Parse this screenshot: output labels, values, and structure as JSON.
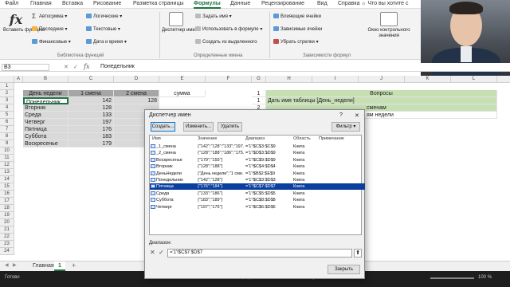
{
  "ribbon_tabs": [
    "Файл",
    "Главная",
    "Вставка",
    "Рисование",
    "Разметка страницы",
    "Формулы",
    "Данные",
    "Рецензирование",
    "Вид",
    "Справка",
    "Что вы хотите с"
  ],
  "ribbon": {
    "insert_function": "Вставить функцию",
    "lib": [
      "Автосумма",
      "Последние",
      "Финансовые",
      "Логические",
      "Текстовые",
      "Дата и время"
    ],
    "lib_group": "Библиотека функций",
    "name_manager": "Диспетчер имен",
    "names": [
      "Задать имя",
      "Использовать в формуле",
      "Создать из выделенного"
    ],
    "names_group": "Определенные имена",
    "audit": [
      "Влияющие ячейки",
      "Зависимые ячейки",
      "Убрать стрелки"
    ],
    "watch": "Окно контрольного значения",
    "audit_group": "Зависимости формул"
  },
  "formula_bar": {
    "namebox": "B3",
    "fx": "fx",
    "value": "Понедельник"
  },
  "columns": [
    "A",
    "B",
    "C",
    "D",
    "E",
    "F",
    "G",
    "H",
    "I",
    "J",
    "K",
    "L",
    "M"
  ],
  "rows": [
    "1",
    "2",
    "3",
    "4",
    "5",
    "6",
    "7",
    "8",
    "9",
    "10",
    "11",
    "12",
    "13",
    "14",
    "15",
    "16",
    "17",
    "18",
    "19",
    "20",
    "21",
    "22",
    "23",
    "24"
  ],
  "table": {
    "headers": [
      "День недели",
      "1 смена",
      "2 смена",
      "сумма"
    ],
    "days": [
      "Понедельник",
      "Вторник",
      "Среда",
      "Четверг",
      "Пятница",
      "Суббота",
      "Воскресенье"
    ],
    "shift1": [
      "142",
      "128",
      "133",
      "197",
      "176",
      "183",
      "179"
    ],
    "shift2": [
      "128"
    ]
  },
  "questions": {
    "header": "Вопросы",
    "nums": [
      "1",
      "2"
    ],
    "q1": "Дать имя таблицы [День_недели]",
    "q2": "сменам",
    "q3": "ям недели"
  },
  "sheet": {
    "tab": "Главная",
    "num": "1",
    "add": "+"
  },
  "status": {
    "ready": "Готово",
    "mid": "Среднее: 164,5   Количество: 14   Сумма: 2303",
    "zoom": "100 %"
  },
  "dialog": {
    "title": "Диспетчер имен",
    "help": "?",
    "close": "✕",
    "buttons": {
      "create": "Создать...",
      "edit": "Изменить...",
      "delete": "Удалить",
      "filter": "Фильтр"
    },
    "columns": {
      "name": "Имя",
      "value": "Значение",
      "range": "Диапазон",
      "scope": "Область",
      "note": "Примечание"
    },
    "rows": [
      {
        "name": "_1_смена",
        "value": "{\"142\";\"128\";\"133\";\"197...",
        "range": "='1'!$C$3:$C$9",
        "scope": "Книга"
      },
      {
        "name": "_2_смена",
        "value": "{\"128\";\"188\";\"186\";\"175...",
        "range": "='1'!$D$3:$D$9",
        "scope": "Книга"
      },
      {
        "name": "Воскресенье",
        "value": "{\"179\";\"155\"}",
        "range": "='1'!$C$9:$D$9",
        "scope": "Книга"
      },
      {
        "name": "Вторник",
        "value": "{\"128\";\"188\"}",
        "range": "='1'!$C$4:$D$4",
        "scope": "Книга"
      },
      {
        "name": "ДеньНедели",
        "value": "{\"День недели\";\"1 сме...",
        "range": "='1'!$B$2:$E$9",
        "scope": "Книга"
      },
      {
        "name": "Понедельник",
        "value": "{\"142\";\"128\"}",
        "range": "='1'!$C$3:$D$3",
        "scope": "Книга"
      },
      {
        "name": "Пятница",
        "value": "{\"176\";\"184\"}",
        "range": "='1'!$C$7:$D$7",
        "scope": "Книга"
      },
      {
        "name": "Среда",
        "value": "{\"133\";\"186\"}",
        "range": "='1'!$C$5:$D$5",
        "scope": "Книга"
      },
      {
        "name": "Суббота",
        "value": "{\"183\";\"189\"}",
        "range": "='1'!$C$8:$D$8",
        "scope": "Книга"
      },
      {
        "name": "Четверг",
        "value": "{\"197\";\"175\"}",
        "range": "='1'!$C$6:$D$6",
        "scope": "Книга"
      }
    ],
    "range_label": "Диапазон:",
    "range_value": "='1'!$C$7:$D$7",
    "close_button": "Закрыть"
  },
  "colors": {
    "accent": "#217346",
    "header_fill": "#a6a6a6",
    "data_fill": "#d9d9d9",
    "question_fill": "#c6e0b4",
    "selection": "#0a3fa0"
  }
}
